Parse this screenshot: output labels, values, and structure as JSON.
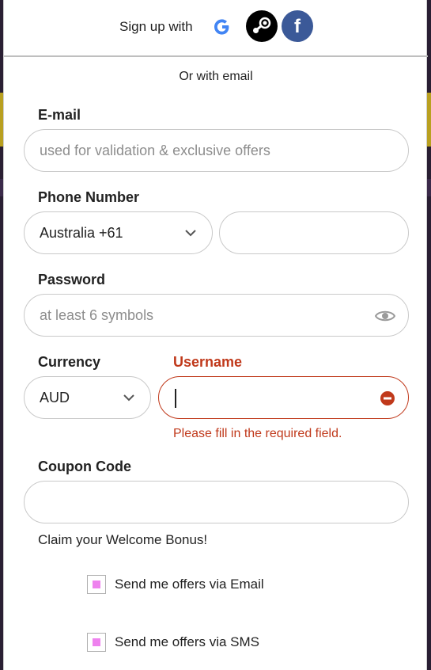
{
  "signup": {
    "title": "Sign up with",
    "google_label": "G",
    "facebook_label": "f",
    "or_email": "Or with email"
  },
  "form": {
    "email": {
      "label": "E-mail",
      "placeholder": "used for validation & exclusive offers",
      "value": ""
    },
    "phone": {
      "label": "Phone Number",
      "country_value": "Australia +61",
      "number_value": ""
    },
    "password": {
      "label": "Password",
      "placeholder": "at least 6 symbols",
      "value": ""
    },
    "currency": {
      "label": "Currency",
      "value": "AUD"
    },
    "username": {
      "label": "Username",
      "value": "",
      "error": "Please fill in the required field."
    },
    "coupon": {
      "label": "Coupon Code",
      "value": "",
      "bonus_text": "Claim your Welcome Bonus!"
    },
    "offers": {
      "email_label": "Send me offers via Email",
      "sms_label": "Send me offers via SMS"
    }
  },
  "colors": {
    "error": "#c0391b",
    "checkbox_fill": "#ee82ee",
    "facebook": "#3b5998",
    "google": "#4285f4"
  },
  "icons": {
    "google": "google-icon",
    "steam": "steam-icon",
    "facebook": "facebook-icon",
    "chevron": "chevron-down-icon",
    "eye": "eye-icon",
    "error": "error-icon"
  }
}
